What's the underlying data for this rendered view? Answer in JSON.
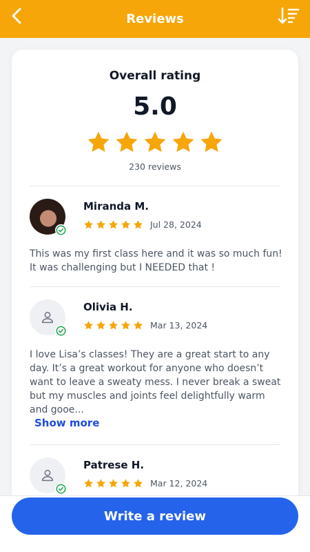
{
  "header": {
    "title": "Reviews",
    "back_icon": "chevron-left-icon",
    "sort_icon": "sort-descending-icon"
  },
  "summary": {
    "title": "Overall rating",
    "score": "5.0",
    "stars": 5,
    "count_text": "230 reviews"
  },
  "reviews": [
    {
      "name": "Miranda M.",
      "date": "Jul 28, 2024",
      "rating": 5,
      "text": "This was my first class here and it was so much fun! It was challenging but I NEEDED that !",
      "verified": true
    },
    {
      "name": "Olivia H.",
      "date": "Mar 13, 2024",
      "rating": 5,
      "text": "I love Lisa’s classes! They are a great start to any day. It’s a great workout for anyone who doesn’t want to leave a sweaty mess. I never break a sweat but my muscles and joints feel delightfully warm and gooe...",
      "verified": true,
      "show_more_label": "Show more"
    },
    {
      "name": "Patrese H.",
      "date": "Mar 12, 2024",
      "rating": 5,
      "verified": true
    }
  ],
  "footer": {
    "write_review_label": "Write a review"
  },
  "colors": {
    "header": "#f6a609",
    "star": "#f6a609",
    "primary_button": "#2563eb",
    "link": "#1d4ed8",
    "verified": "#16a34a"
  }
}
